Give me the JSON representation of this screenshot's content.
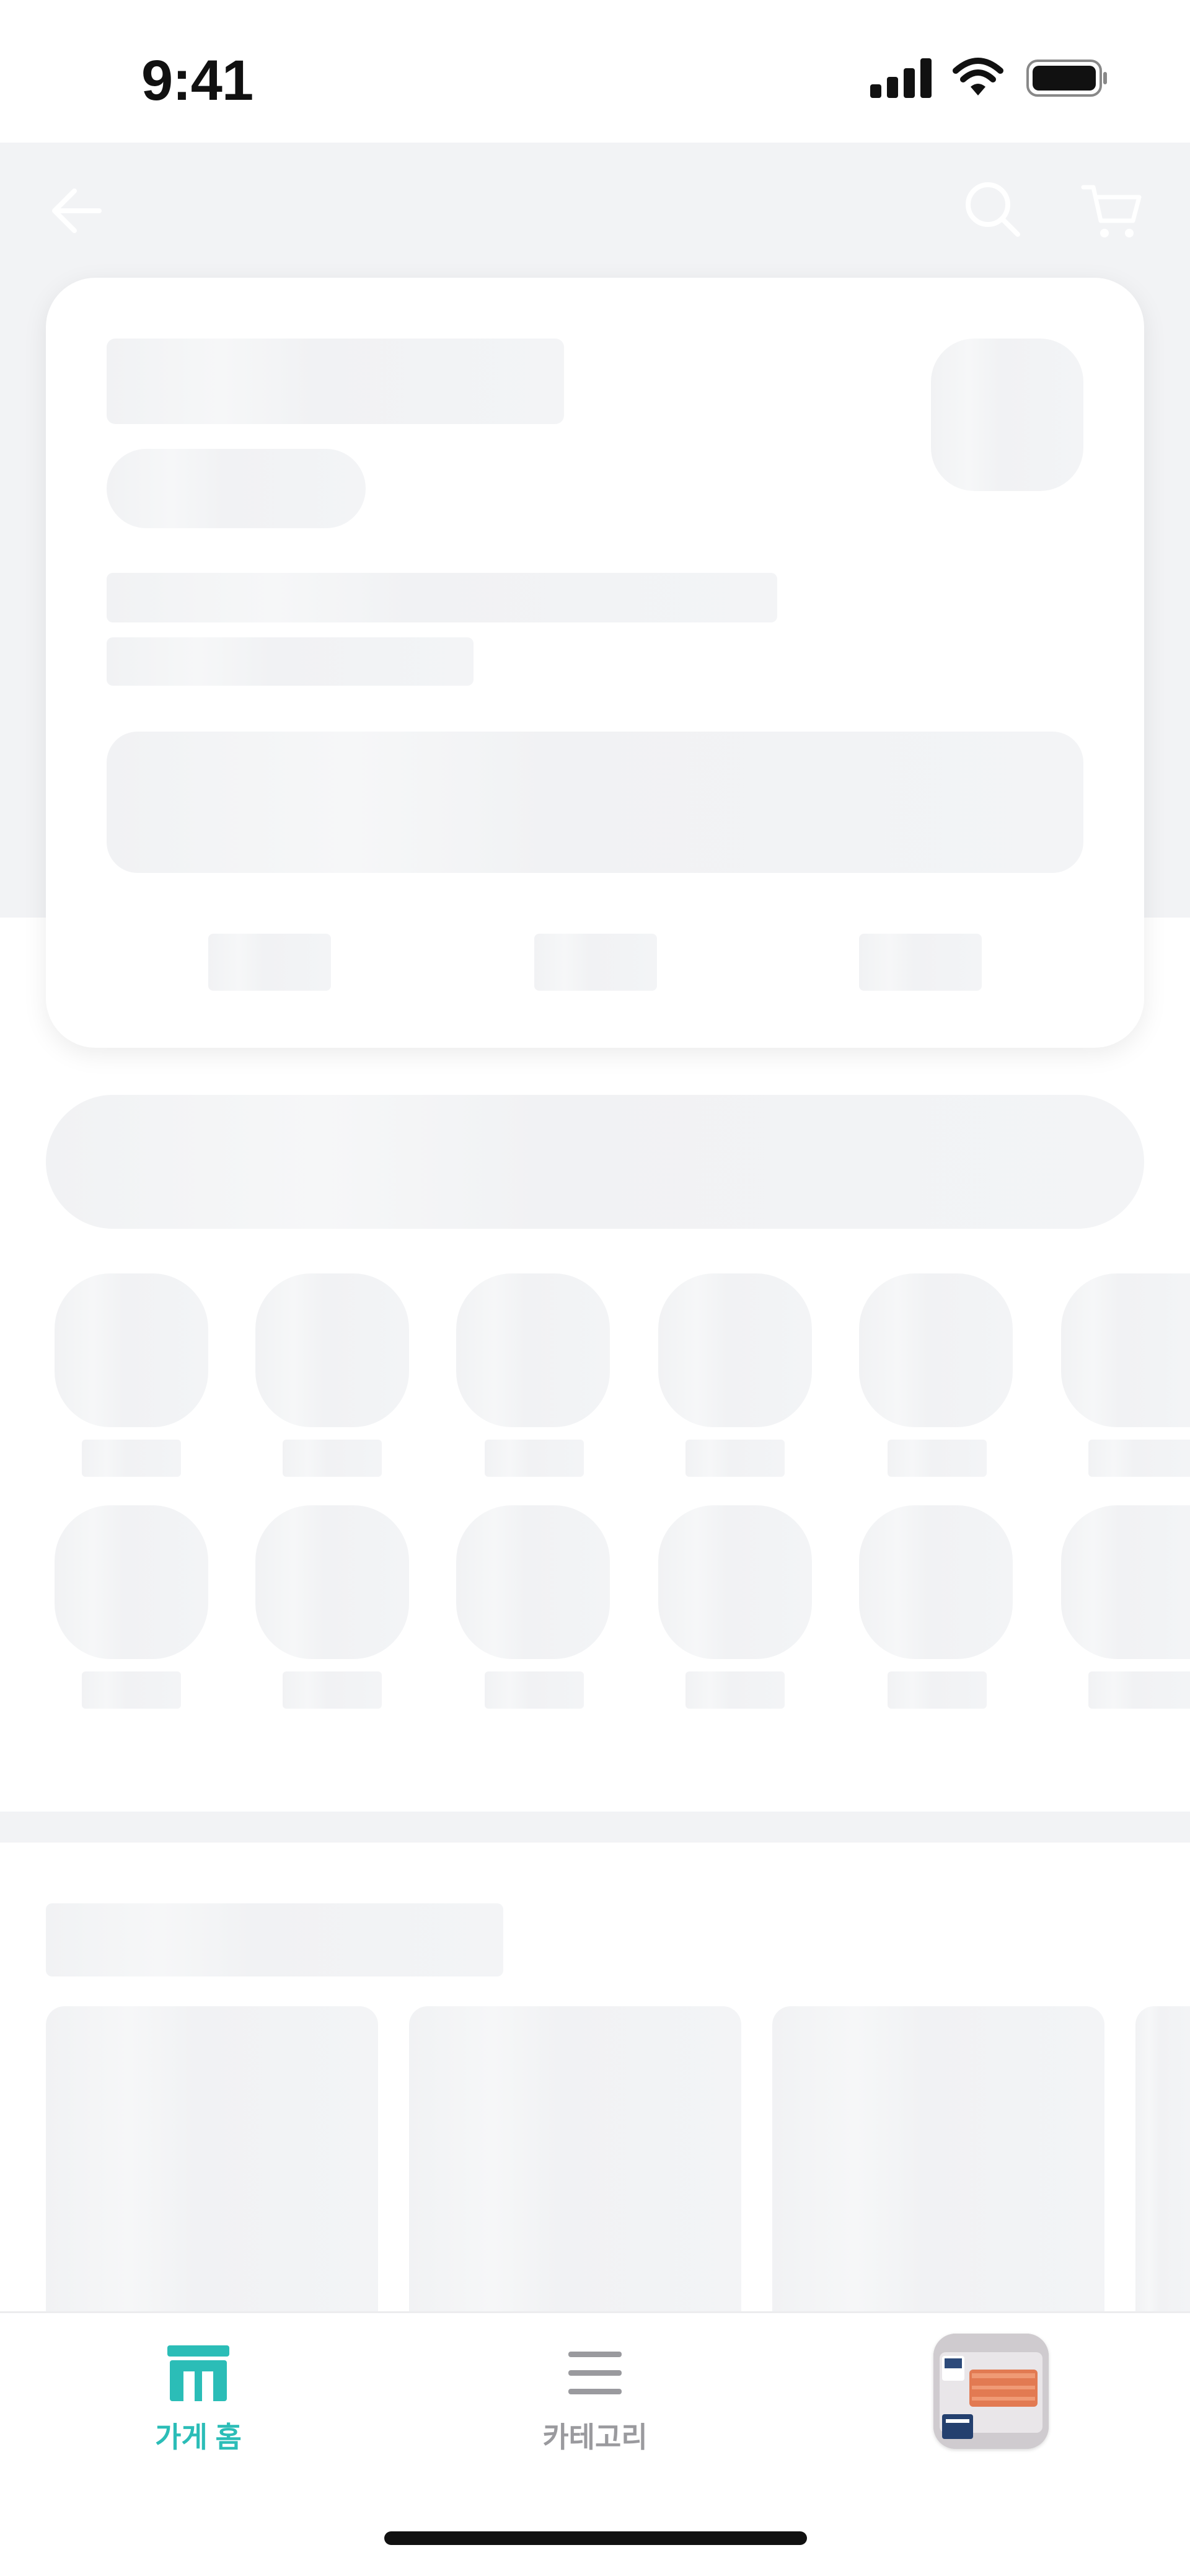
{
  "status_bar": {
    "time": "9:41"
  },
  "header": {
    "back_icon": "arrow-left-icon",
    "search_icon": "search-icon",
    "cart_icon": "cart-icon"
  },
  "tab_bar": {
    "items": [
      {
        "label": "가게 홈",
        "icon": "store-icon",
        "active": true,
        "color": "#2bbdb7"
      },
      {
        "label": "카테고리",
        "icon": "menu-icon",
        "active": false,
        "color": "#9a9a9e"
      }
    ],
    "cart_preview_icon": "product-thumbnail"
  },
  "colors": {
    "accent": "#2bbdb7",
    "skeleton": "#f2f3f5",
    "background": "#ffffff"
  }
}
